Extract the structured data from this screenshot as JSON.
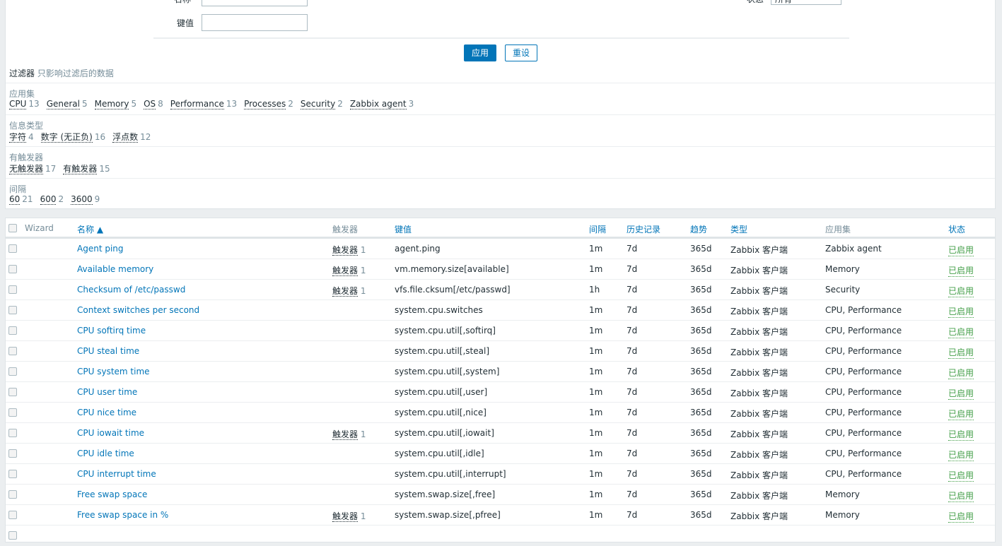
{
  "filter": {
    "name_label": "名称",
    "key_label": "键值",
    "status_label": "状态",
    "status_value": "所有",
    "apply": "应用",
    "reset": "重设",
    "title": "过滤器",
    "subtitle": "只影响过滤后的数据",
    "groups": [
      {
        "label": "应用集",
        "values": [
          {
            "name": "CPU",
            "count": "13"
          },
          {
            "name": "General",
            "count": "5"
          },
          {
            "name": "Memory",
            "count": "5"
          },
          {
            "name": "OS",
            "count": "8"
          },
          {
            "name": "Performance",
            "count": "13"
          },
          {
            "name": "Processes",
            "count": "2"
          },
          {
            "name": "Security",
            "count": "2"
          },
          {
            "name": "Zabbix agent",
            "count": "3"
          }
        ]
      },
      {
        "label": "信息类型",
        "values": [
          {
            "name": "字符",
            "count": "4"
          },
          {
            "name": "数字 (无正负)",
            "count": "16"
          },
          {
            "name": "浮点数",
            "count": "12"
          }
        ]
      },
      {
        "label": "有触发器",
        "values": [
          {
            "name": "无触发器",
            "count": "17"
          },
          {
            "name": "有触发器",
            "count": "15"
          }
        ]
      },
      {
        "label": "间隔",
        "values": [
          {
            "name": "60",
            "count": "21"
          },
          {
            "name": "600",
            "count": "2"
          },
          {
            "name": "3600",
            "count": "9"
          }
        ]
      }
    ]
  },
  "table": {
    "headers": {
      "wizard": "Wizard",
      "name": "名称 ▲",
      "triggers": "触发器",
      "key": "键值",
      "interval": "间隔",
      "history": "历史记录",
      "trends": "趋势",
      "type": "类型",
      "apps": "应用集",
      "status": "状态"
    },
    "rows": [
      {
        "name": "Agent ping",
        "triggers": "触发器",
        "tcount": "1",
        "key": "agent.ping",
        "interval": "1m",
        "history": "7d",
        "trends": "365d",
        "type": "Zabbix 客户端",
        "apps": "Zabbix agent",
        "status": "已启用"
      },
      {
        "name": "Available memory",
        "triggers": "触发器",
        "tcount": "1",
        "key": "vm.memory.size[available]",
        "interval": "1m",
        "history": "7d",
        "trends": "365d",
        "type": "Zabbix 客户端",
        "apps": "Memory",
        "status": "已启用"
      },
      {
        "name": "Checksum of /etc/passwd",
        "triggers": "触发器",
        "tcount": "1",
        "key": "vfs.file.cksum[/etc/passwd]",
        "interval": "1h",
        "history": "7d",
        "trends": "365d",
        "type": "Zabbix 客户端",
        "apps": "Security",
        "status": "已启用"
      },
      {
        "name": "Context switches per second",
        "triggers": "",
        "tcount": "",
        "key": "system.cpu.switches",
        "interval": "1m",
        "history": "7d",
        "trends": "365d",
        "type": "Zabbix 客户端",
        "apps": "CPU, Performance",
        "status": "已启用"
      },
      {
        "name": "CPU softirq time",
        "triggers": "",
        "tcount": "",
        "key": "system.cpu.util[,softirq]",
        "interval": "1m",
        "history": "7d",
        "trends": "365d",
        "type": "Zabbix 客户端",
        "apps": "CPU, Performance",
        "status": "已启用"
      },
      {
        "name": "CPU steal time",
        "triggers": "",
        "tcount": "",
        "key": "system.cpu.util[,steal]",
        "interval": "1m",
        "history": "7d",
        "trends": "365d",
        "type": "Zabbix 客户端",
        "apps": "CPU, Performance",
        "status": "已启用"
      },
      {
        "name": "CPU system time",
        "triggers": "",
        "tcount": "",
        "key": "system.cpu.util[,system]",
        "interval": "1m",
        "history": "7d",
        "trends": "365d",
        "type": "Zabbix 客户端",
        "apps": "CPU, Performance",
        "status": "已启用"
      },
      {
        "name": "CPU user time",
        "triggers": "",
        "tcount": "",
        "key": "system.cpu.util[,user]",
        "interval": "1m",
        "history": "7d",
        "trends": "365d",
        "type": "Zabbix 客户端",
        "apps": "CPU, Performance",
        "status": "已启用"
      },
      {
        "name": "CPU nice time",
        "triggers": "",
        "tcount": "",
        "key": "system.cpu.util[,nice]",
        "interval": "1m",
        "history": "7d",
        "trends": "365d",
        "type": "Zabbix 客户端",
        "apps": "CPU, Performance",
        "status": "已启用"
      },
      {
        "name": "CPU iowait time",
        "triggers": "触发器",
        "tcount": "1",
        "key": "system.cpu.util[,iowait]",
        "interval": "1m",
        "history": "7d",
        "trends": "365d",
        "type": "Zabbix 客户端",
        "apps": "CPU, Performance",
        "status": "已启用"
      },
      {
        "name": "CPU idle time",
        "triggers": "",
        "tcount": "",
        "key": "system.cpu.util[,idle]",
        "interval": "1m",
        "history": "7d",
        "trends": "365d",
        "type": "Zabbix 客户端",
        "apps": "CPU, Performance",
        "status": "已启用"
      },
      {
        "name": "CPU interrupt time",
        "triggers": "",
        "tcount": "",
        "key": "system.cpu.util[,interrupt]",
        "interval": "1m",
        "history": "7d",
        "trends": "365d",
        "type": "Zabbix 客户端",
        "apps": "CPU, Performance",
        "status": "已启用"
      },
      {
        "name": "Free swap space",
        "triggers": "",
        "tcount": "",
        "key": "system.swap.size[,free]",
        "interval": "1m",
        "history": "7d",
        "trends": "365d",
        "type": "Zabbix 客户端",
        "apps": "Memory",
        "status": "已启用"
      },
      {
        "name": "Free swap space in %",
        "triggers": "触发器",
        "tcount": "1",
        "key": "system.swap.size[,pfree]",
        "interval": "1m",
        "history": "7d",
        "trends": "365d",
        "type": "Zabbix 客户端",
        "apps": "Memory",
        "status": "已启用"
      }
    ]
  }
}
